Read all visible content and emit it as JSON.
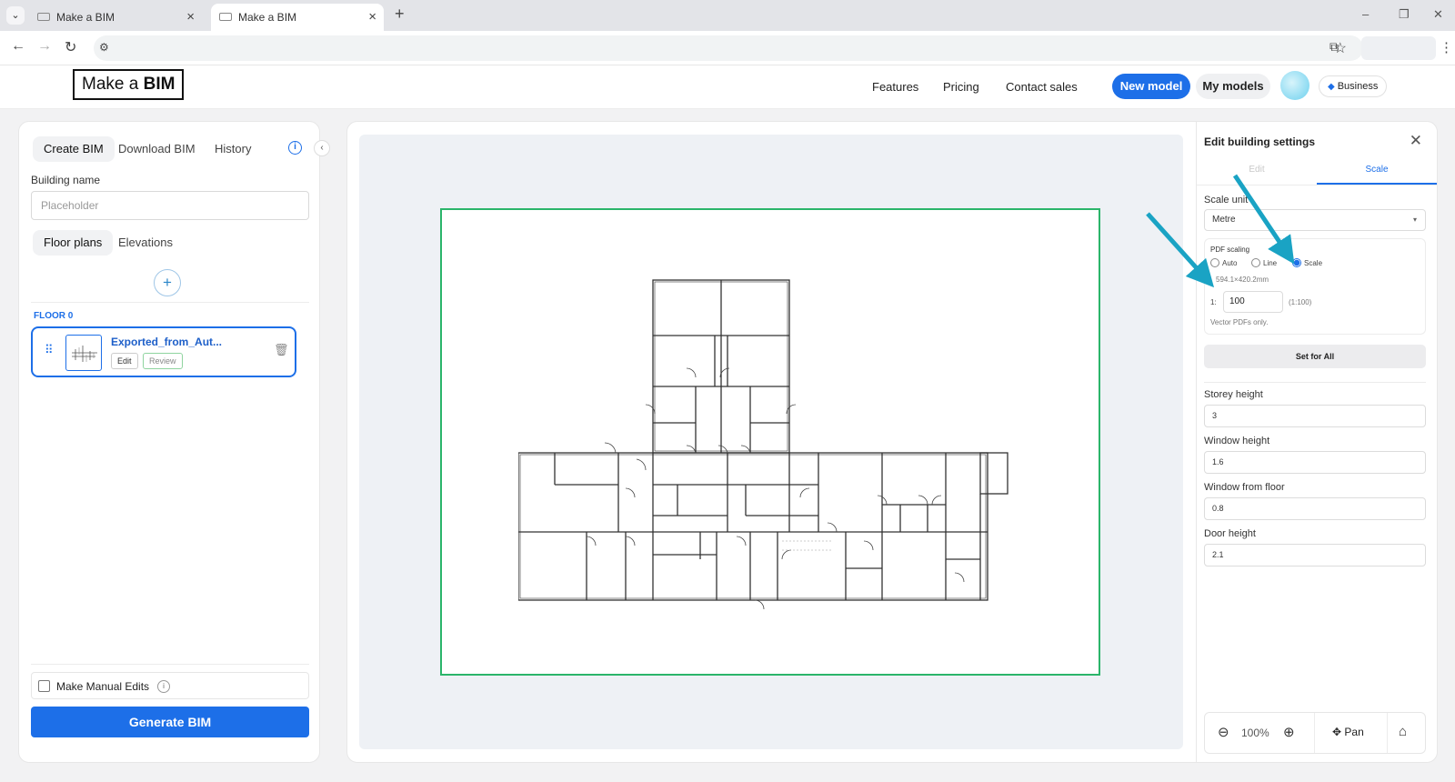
{
  "browser": {
    "tabs": [
      {
        "title": "Make a BIM",
        "active": false
      },
      {
        "title": "Make a BIM",
        "active": true
      }
    ]
  },
  "header": {
    "logo_text": "Make a ",
    "logo_bold": "BIM",
    "nav": [
      "Features",
      "Pricing",
      "Contact sales"
    ],
    "new_model": "New model",
    "my_models": "My models",
    "plan_badge": "Business"
  },
  "left": {
    "tabs": [
      "Create BIM",
      "Download BIM",
      "History"
    ],
    "building_name_label": "Building name",
    "building_name_placeholder": "Placeholder",
    "plan_tabs": [
      "Floor plans",
      "Elevations"
    ],
    "add_symbol": "+",
    "floor_label": "FLOOR 0",
    "file_name": "Exported_from_Aut...",
    "edit": "Edit",
    "review": "Review",
    "manual_edits": "Make Manual Edits",
    "manual_info": "i",
    "generate": "Generate BIM"
  },
  "settings": {
    "title": "Edit building settings",
    "tabs": [
      "Edit",
      "Scale"
    ],
    "active_tab": "Scale",
    "scale_unit_label": "Scale unit",
    "scale_unit_value": "Metre",
    "pdf_scaling_label": "PDF scaling",
    "radio_options": [
      "Auto",
      "Line",
      "Scale"
    ],
    "radio_selected": "Scale",
    "sheet_dims": "594.1×420.2mm",
    "scale_prefix": "1:",
    "scale_value": "100",
    "scale_ratio": "(1:100)",
    "vector_note": "Vector PDFs only.",
    "set_for_all": "Set for All",
    "storey_height_label": "Storey height",
    "storey_height": "3",
    "window_height_label": "Window height",
    "window_height": "1.6",
    "window_from_floor_label": "Window from floor",
    "window_from_floor": "0.8",
    "door_height_label": "Door height",
    "door_height": "2.1"
  },
  "viewer": {
    "zoom": "100%",
    "pan": "Pan"
  },
  "colors": {
    "primary": "#1d6fe8",
    "sheet_border": "#2bb56a",
    "annotation_arrow": "#1aa3c4"
  }
}
